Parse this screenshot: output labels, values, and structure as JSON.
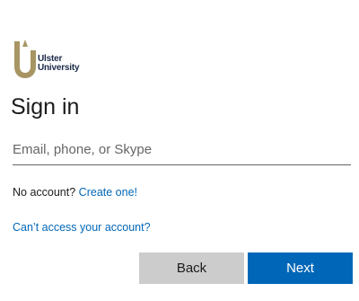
{
  "logo": {
    "line1": "Ulster",
    "line2": "University",
    "mark_color": "#a89564",
    "text_color": "#1b2a4a"
  },
  "title": "Sign in",
  "email": {
    "placeholder": "Email, phone, or Skype",
    "value": ""
  },
  "no_account": {
    "prefix": "No account?",
    "link": "Create one!"
  },
  "cant_access": "Can’t access your account?",
  "buttons": {
    "back": "Back",
    "next": "Next"
  },
  "colors": {
    "accent": "#0067b8",
    "secondary_button": "#cccccc"
  }
}
